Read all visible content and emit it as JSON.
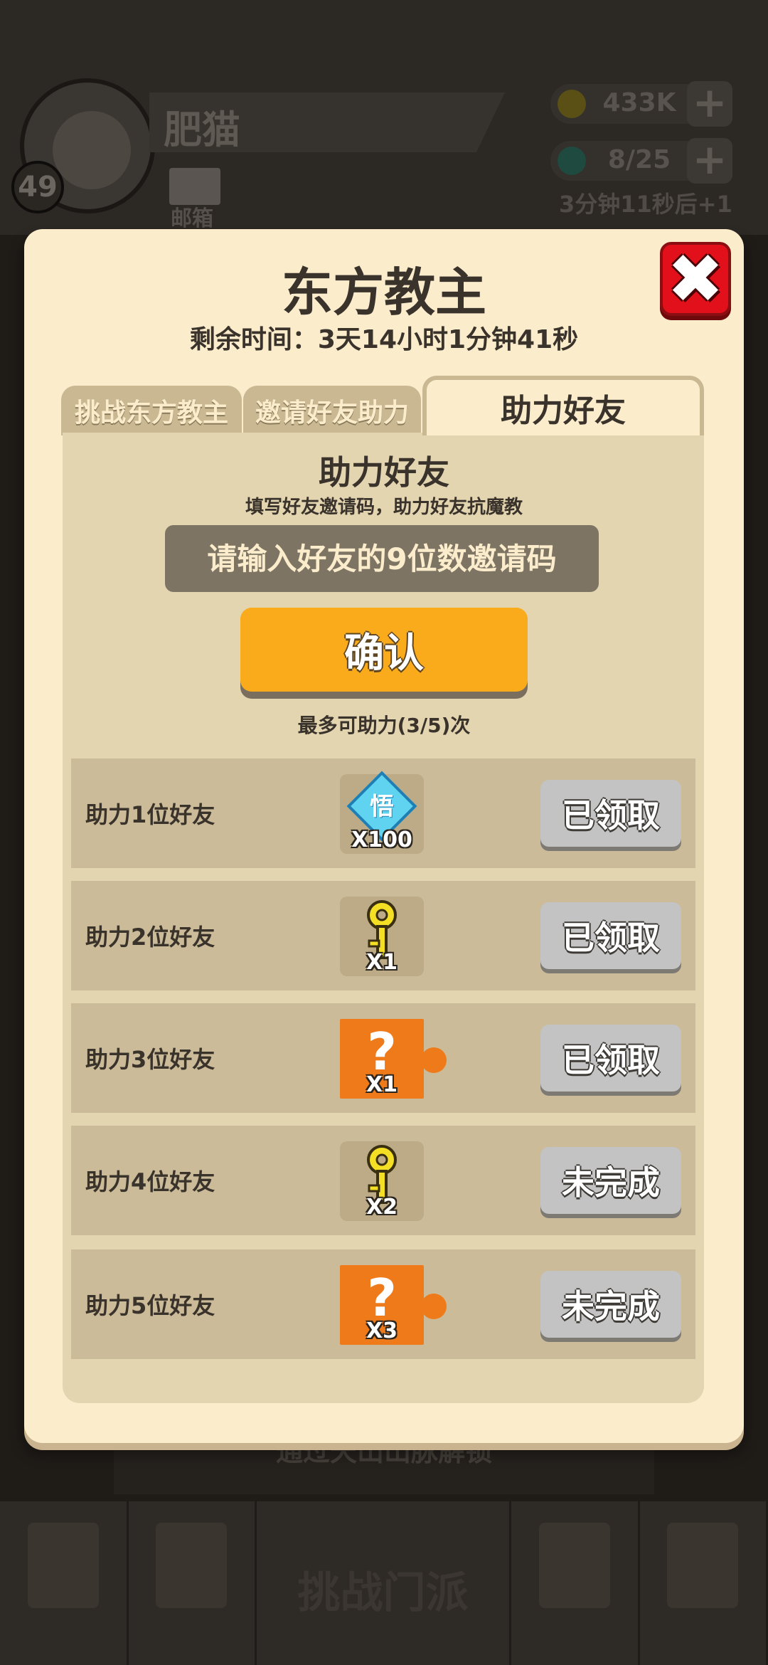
{
  "header": {
    "player_name": "肥猫",
    "level": "49",
    "mail_label": "邮箱",
    "gold": "433K",
    "energy": "8/25",
    "energy_timer": "3分钟11秒后+1"
  },
  "popup": {
    "title": "东方教主",
    "remaining_time": "剩余时间：3天14小时1分钟41秒",
    "tabs": [
      {
        "label": "挑战东方教主",
        "active": false
      },
      {
        "label": "邀请好友助力",
        "active": false
      },
      {
        "label": "助力好友",
        "active": true
      }
    ],
    "panel_title": "助力好友",
    "panel_subtitle": "填写好友邀请码，助力好友抗魔教",
    "input_placeholder": "请输入好友的9位数邀请码",
    "confirm_label": "确认",
    "limit_text": "最多可助力(3/5)次",
    "rewards": [
      {
        "label": "助力1位好友",
        "item_icon": "comprehension-gem-icon",
        "item_char": "悟",
        "qty": "X100",
        "status": "已领取"
      },
      {
        "label": "助力2位好友",
        "item_icon": "gold-key-icon",
        "qty": "X1",
        "status": "已领取"
      },
      {
        "label": "助力3位好友",
        "item_icon": "mystery-box-icon",
        "qty": "X1",
        "status": "已领取"
      },
      {
        "label": "助力4位好友",
        "item_icon": "gold-key-icon",
        "qty": "X2",
        "status": "未完成"
      },
      {
        "label": "助力5位好友",
        "item_icon": "mystery-box-icon",
        "qty": "X3",
        "status": "未完成"
      }
    ],
    "close_glyph": "✖"
  },
  "background": {
    "banner_text": "通过天山山脉解锁",
    "nav_challenge_label": "挑战门派"
  },
  "colors": {
    "popup_bg": "#fbeccc",
    "panel_bg": "#e4d5b1",
    "row_bg": "#cbbb98",
    "confirm_orange": "#f9ab1b",
    "close_red": "#e2101a",
    "button_gray": "#c3c3c3",
    "item_orange": "#ee7a1a"
  }
}
